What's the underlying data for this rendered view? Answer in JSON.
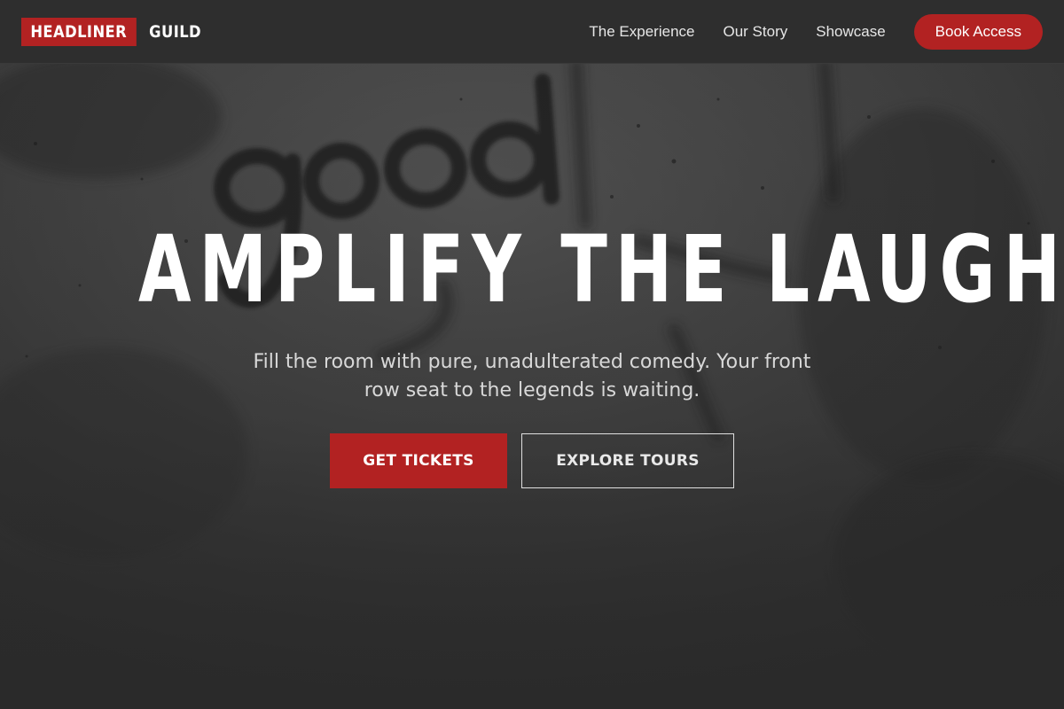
{
  "nav": {
    "logo_primary": "HEADLINER",
    "logo_secondary": "GUILD",
    "links": [
      "The Experience",
      "Our Story",
      "Showcase"
    ],
    "cta": "Book Access"
  },
  "hero": {
    "title": "AMPLIFY THE LAUGHTER",
    "subtitle": "Fill the room with pure, unadulterated comedy. Your front row seat to the legends is waiting.",
    "primary_button": "GET TICKETS",
    "secondary_button": "EXPLORE TOURS",
    "background_graffiti": "good"
  },
  "colors": {
    "accent": "#b22222",
    "nav_background": "#2e2e2e",
    "hero_background": "#333333",
    "text": "#ffffff"
  }
}
